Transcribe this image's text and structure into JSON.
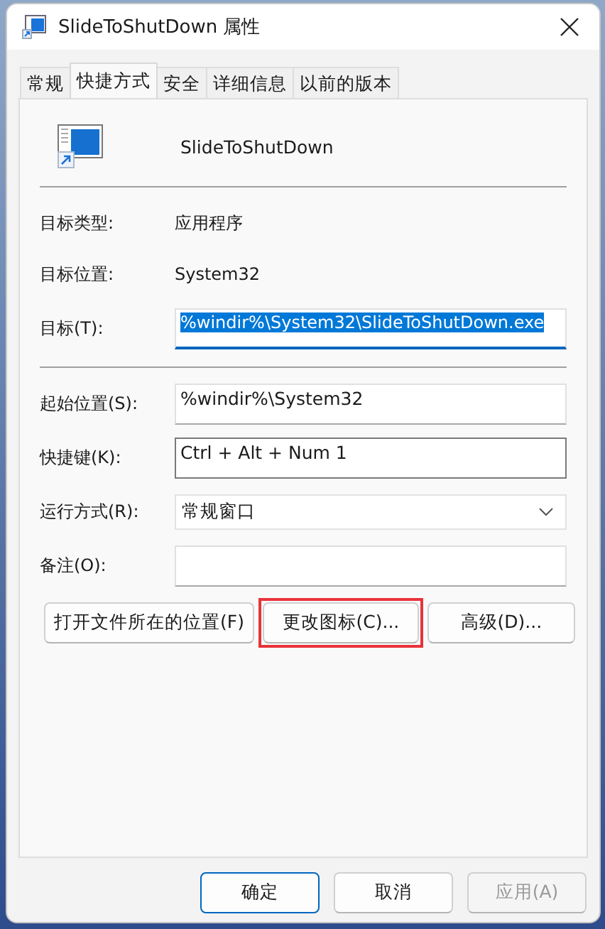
{
  "window": {
    "title": "SlideToShutDown 属性"
  },
  "tabs": [
    {
      "label": "常规",
      "selected": false
    },
    {
      "label": "快捷方式",
      "selected": true
    },
    {
      "label": "安全",
      "selected": false
    },
    {
      "label": "详细信息",
      "selected": false
    },
    {
      "label": "以前的版本",
      "selected": false
    }
  ],
  "header": {
    "name": "SlideToShutDown"
  },
  "info": [
    {
      "label": "目标类型:",
      "value": "应用程序"
    },
    {
      "label": "目标位置:",
      "value": "System32"
    }
  ],
  "target": {
    "label": "目标(T):",
    "value": "%windir%\\System32\\SlideToShutDown.exe",
    "selected": true
  },
  "fields": [
    {
      "kind": "text",
      "label": "起始位置(S):",
      "value": "%windir%\\System32"
    },
    {
      "kind": "hotkey",
      "label": "快捷键(K):",
      "value": "Ctrl + Alt + Num 1"
    },
    {
      "kind": "select",
      "label": "运行方式(R):",
      "value": "常规窗口"
    },
    {
      "kind": "text",
      "label": "备注(O):"
    }
  ],
  "actions": [
    {
      "label": "打开文件所在的位置(F)",
      "highlighted": false
    },
    {
      "label": "更改图标(C)...",
      "highlighted": true
    },
    {
      "label": "高级(D)...",
      "highlighted": false
    }
  ],
  "footer": [
    {
      "label": "确定",
      "default": true,
      "disabled": false
    },
    {
      "label": "取消",
      "default": false,
      "disabled": false
    },
    {
      "label": "应用(A)",
      "default": false,
      "disabled": true
    }
  ]
}
